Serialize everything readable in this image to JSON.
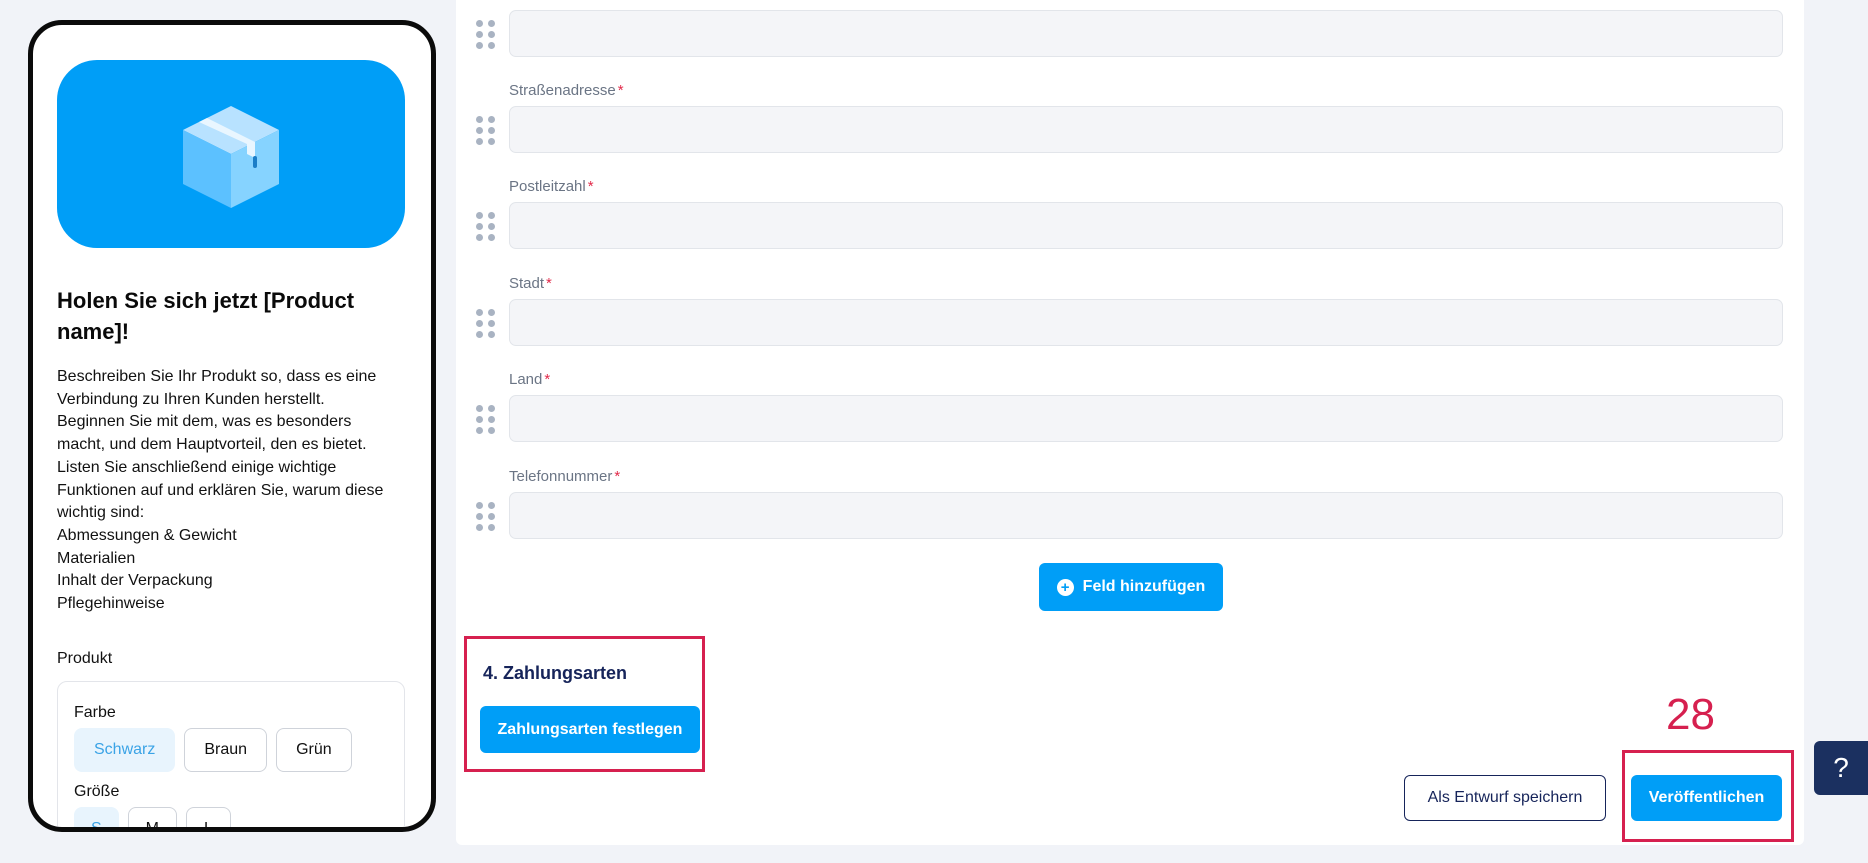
{
  "preview": {
    "title": "Holen Sie sich jetzt [Product name]!",
    "description_lines": [
      "Beschreiben Sie Ihr Produkt so, dass es eine",
      "Verbindung zu Ihren Kunden herstellt.",
      "Beginnen Sie mit dem, was es besonders",
      "macht, und dem Hauptvorteil, den es bietet.",
      "Listen Sie anschließend einige wichtige",
      "Funktionen auf und erklären Sie, warum diese",
      "wichtig sind:",
      "Abmessungen & Gewicht",
      "Materialien",
      "Inhalt der Verpackung",
      "Pflegehinweise"
    ],
    "product_label": "Produkt",
    "color_label": "Farbe",
    "colors": [
      "Schwarz",
      "Braun",
      "Grün"
    ],
    "selected_color": "Schwarz",
    "size_label": "Größe",
    "sizes": [
      "S",
      "M",
      "L"
    ],
    "selected_size": "S",
    "hero_color": "#009ef7",
    "hero_icon": "box-icon"
  },
  "form": {
    "fields": [
      {
        "label": "",
        "required": false
      },
      {
        "label": "Straßenadresse",
        "required": true
      },
      {
        "label": "Postleitzahl",
        "required": true
      },
      {
        "label": "Stadt",
        "required": true
      },
      {
        "label": "Land",
        "required": true
      },
      {
        "label": "Telefonnummer",
        "required": true
      }
    ],
    "required_marker": "*",
    "add_field_label": "Feld hinzufügen"
  },
  "payment": {
    "title": "4. Zahlungsarten",
    "set_button": "Zahlungsarten festlegen"
  },
  "actions": {
    "draft_label": "Als Entwurf speichern",
    "publish_label": "Veröffentlichen"
  },
  "annotation": {
    "step_number": "28"
  },
  "help": {
    "label": "?"
  },
  "colors": {
    "accent": "#009ef7",
    "navy": "#16245a",
    "highlight": "#d6204f"
  }
}
